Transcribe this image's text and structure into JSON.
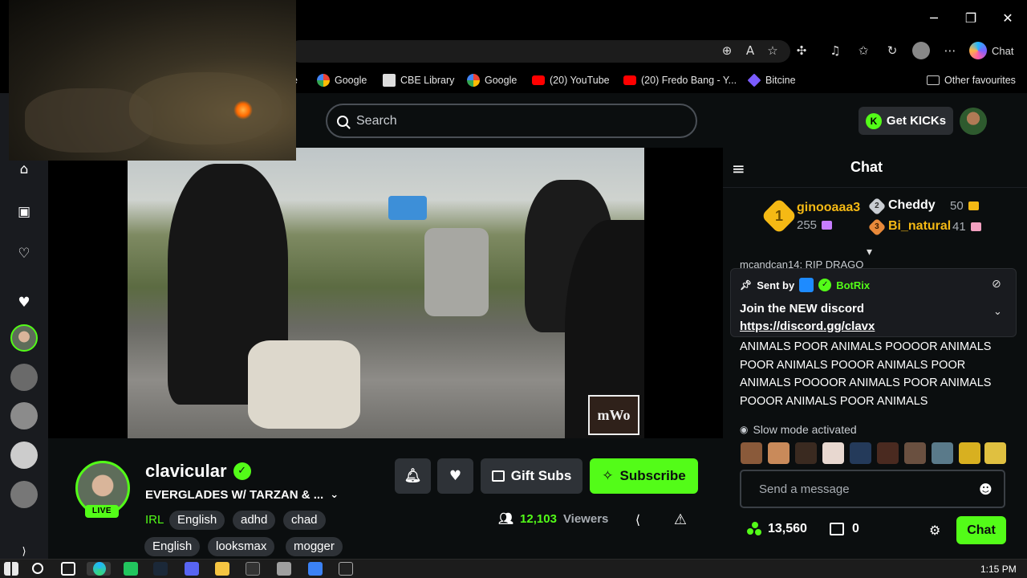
{
  "browser": {
    "window_controls": {
      "minimize": "─",
      "maximize": "❐",
      "close": "✕"
    },
    "copilot_label": "Chat",
    "bookmarks": [
      {
        "label": "e",
        "icon": "web-icon"
      },
      {
        "label": "Google",
        "icon": "google-icon"
      },
      {
        "label": "CBE Library",
        "icon": "cbe-library-icon"
      },
      {
        "label": "Google",
        "icon": "google-icon"
      },
      {
        "label": "(20) YouTube",
        "icon": "youtube-icon"
      },
      {
        "label": "(20) Fredo Bang - Y...",
        "icon": "youtube-icon"
      },
      {
        "label": "Bitcine",
        "icon": "bitcine-icon"
      }
    ],
    "other_favourites": "Other favourites"
  },
  "header": {
    "search_placeholder": "Search",
    "get_kicks_label": "Get KICKs",
    "kicks_glyph": "K"
  },
  "stream": {
    "watermark": "mWo",
    "channel_name": "clavicular",
    "live_label": "LIVE",
    "title": "EVERGLADES W/ TARZAN & ...",
    "category": "IRL",
    "tags": [
      "English",
      "adhd",
      "chad",
      "English",
      "looksmax",
      "mogger"
    ],
    "gift_subs_label": "Gift Subs",
    "subscribe_label": "Subscribe",
    "viewers_count": "12,103",
    "viewers_label": "Viewers"
  },
  "chat": {
    "title": "Chat",
    "leaderboard": [
      {
        "rank": "1",
        "name": "ginooaaa3",
        "count": "255"
      },
      {
        "rank": "2",
        "name": "Cheddy",
        "count": "50"
      },
      {
        "rank": "3",
        "name": "Bi_natural",
        "count": "41"
      }
    ],
    "cut_message": "mcandcan14: RIP DRAGO",
    "pinned": {
      "sent_by_label": "Sent by",
      "bot_name": "BotRix",
      "line1": "Join the NEW discord",
      "link": "https://discord.gg/clavx"
    },
    "message_body": "ANIMALS POOR ANIMALS POOOOR ANIMALS POOR ANIMALS POOOR ANIMALS POOR ANIMALS POOOOR ANIMALS POOR ANIMALS POOOR ANIMALS POOR ANIMALS",
    "slow_mode": "Slow mode activated",
    "input_placeholder": "Send a message",
    "points": "13,560",
    "store_count": "0",
    "send_label": "Chat"
  },
  "taskbar": {
    "clock": "1:15 PM"
  },
  "colors": {
    "kick_green": "#53fc18",
    "background": "#0b0e0f",
    "sidebar": "#191b1f",
    "button_gray": "#2e3237",
    "gold": "#f5b914"
  }
}
